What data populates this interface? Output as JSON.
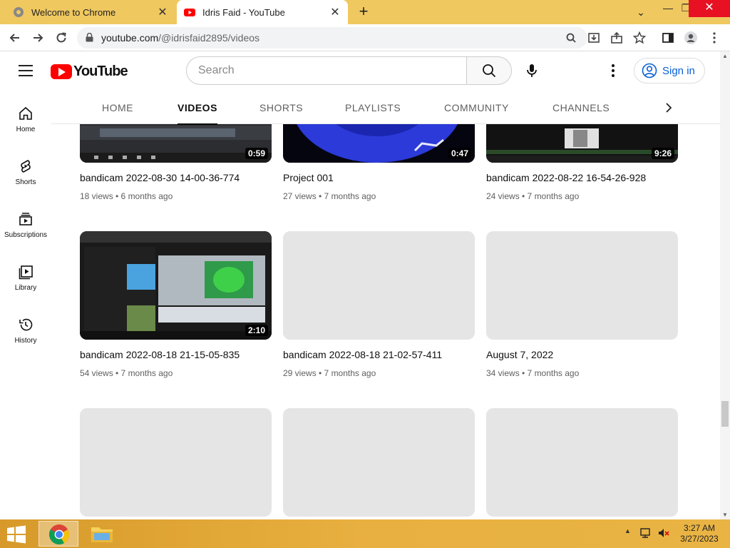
{
  "browser": {
    "tabs": [
      {
        "title": "Welcome to Chrome",
        "active": false
      },
      {
        "title": "Idris Faid - YouTube",
        "active": true
      }
    ],
    "new_tab": "+",
    "url_host": "youtube.com",
    "url_path": "/@idrisfaid2895/videos",
    "window_controls": {
      "minimize": "—",
      "maximize": "❐",
      "close": "✕"
    }
  },
  "youtube": {
    "logo_text": "YouTube",
    "search_placeholder": "Search",
    "sign_in": "Sign in",
    "sidebar": [
      {
        "label": "Home",
        "icon": "home-icon"
      },
      {
        "label": "Shorts",
        "icon": "shorts-icon"
      },
      {
        "label": "Subscriptions",
        "icon": "subscriptions-icon"
      },
      {
        "label": "Library",
        "icon": "library-icon"
      },
      {
        "label": "History",
        "icon": "history-icon"
      }
    ],
    "channel_tabs": [
      {
        "label": "HOME",
        "active": false
      },
      {
        "label": "VIDEOS",
        "active": true
      },
      {
        "label": "SHORTS",
        "active": false
      },
      {
        "label": "PLAYLISTS",
        "active": false
      },
      {
        "label": "COMMUNITY",
        "active": false
      },
      {
        "label": "CHANNELS",
        "active": false
      }
    ],
    "videos": [
      {
        "title": "bandicam 2022-08-30 14-00-36-774",
        "meta": "18 views • 6 months ago",
        "duration": "0:59",
        "loaded": true
      },
      {
        "title": "Project 001",
        "meta": "27 views • 7 months ago",
        "duration": "0:47",
        "loaded": true
      },
      {
        "title": "bandicam 2022-08-22 16-54-26-928",
        "meta": "24 views • 7 months ago",
        "duration": "9:26",
        "loaded": true
      },
      {
        "title": "bandicam 2022-08-18 21-15-05-835",
        "meta": "54 views • 7 months ago",
        "duration": "2:10",
        "loaded": true
      },
      {
        "title": "bandicam 2022-08-18 21-02-57-411",
        "meta": "29 views • 7 months ago",
        "duration": "",
        "loaded": false
      },
      {
        "title": "August 7, 2022",
        "meta": "34 views • 7 months ago",
        "duration": "",
        "loaded": false
      },
      {
        "title": "",
        "meta": "",
        "duration": "",
        "loaded": false
      },
      {
        "title": "",
        "meta": "",
        "duration": "",
        "loaded": false
      },
      {
        "title": "",
        "meta": "",
        "duration": "",
        "loaded": false
      }
    ]
  },
  "taskbar": {
    "time": "3:27 AM",
    "date": "3/27/2023"
  }
}
